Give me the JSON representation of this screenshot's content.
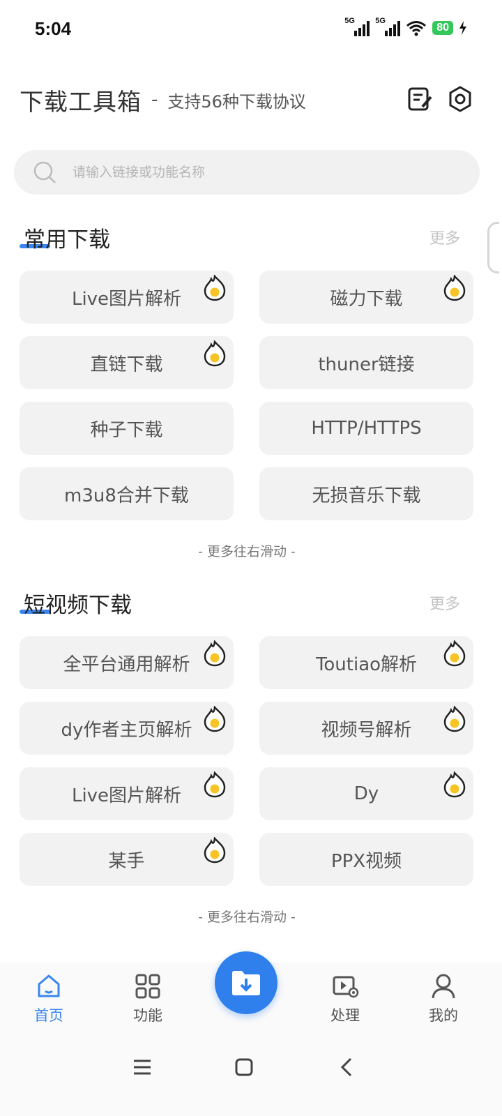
{
  "status_bar": {
    "time": "5:04",
    "signal1": "5G",
    "signal2": "5G",
    "battery": "80"
  },
  "header": {
    "title": "下载工具箱",
    "separator": "-",
    "subtitle": "支持56种下载协议",
    "notes_icon": "notes-edit-icon",
    "settings_icon": "gear-icon"
  },
  "search": {
    "placeholder": "请输入链接或功能名称"
  },
  "sections": [
    {
      "title": "常用下载",
      "more": "更多",
      "hint": "- 更多往右滑动 -",
      "tiles": [
        {
          "label": "Live图片解析",
          "hot": true
        },
        {
          "label": "磁力下载",
          "hot": true
        },
        {
          "label": "直链下载",
          "hot": true
        },
        {
          "label": "thuner链接",
          "hot": false
        },
        {
          "label": "种子下载",
          "hot": false
        },
        {
          "label": "HTTP/HTTPS",
          "hot": false
        },
        {
          "label": "m3u8合并下载",
          "hot": false
        },
        {
          "label": "无损音乐下载",
          "hot": false
        }
      ]
    },
    {
      "title": "短视频下载",
      "more": "更多",
      "hint": "- 更多往右滑动 -",
      "tiles": [
        {
          "label": "全平台通用解析",
          "hot": true
        },
        {
          "label": "Toutiao解析",
          "hot": true
        },
        {
          "label": "dy作者主页解析",
          "hot": true
        },
        {
          "label": "视频号解析",
          "hot": true
        },
        {
          "label": "Live图片解析",
          "hot": true
        },
        {
          "label": "Dy",
          "hot": true
        },
        {
          "label": "某手",
          "hot": true
        },
        {
          "label": "PPX视频",
          "hot": false
        }
      ]
    }
  ],
  "bottom_nav": {
    "items": [
      {
        "label": "首页",
        "icon": "home-icon",
        "active": true
      },
      {
        "label": "功能",
        "icon": "grid-icon",
        "active": false
      },
      {
        "label": "处理",
        "icon": "video-process-icon",
        "active": false
      },
      {
        "label": "我的",
        "icon": "user-icon",
        "active": false
      }
    ],
    "fab_icon": "download-folder-icon"
  },
  "colors": {
    "accent": "#2f80ed",
    "hot_badge": "#f7c325",
    "tile_bg": "#f2f2f3"
  }
}
